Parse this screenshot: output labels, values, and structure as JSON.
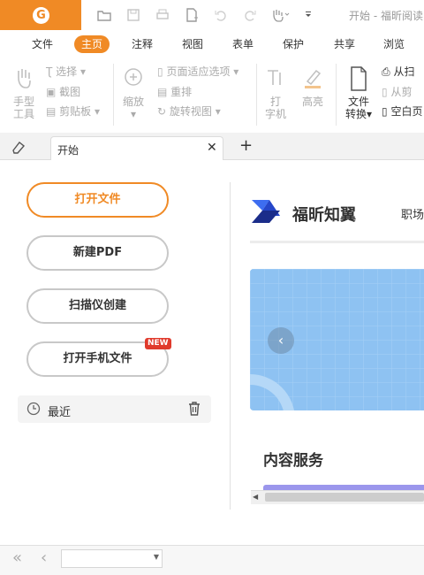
{
  "titlebar": {
    "logo_letter": "G",
    "window_title": "开始 - 福昕阅读",
    "quick_access": [
      "folder-open-icon",
      "save-icon",
      "print-icon",
      "new-doc-icon",
      "undo-icon",
      "redo-icon",
      "hand-tool-icon",
      "customize-icon"
    ]
  },
  "menu": {
    "tabs": [
      "文件",
      "主页",
      "注释",
      "视图",
      "表单",
      "保护",
      "共享",
      "浏览"
    ],
    "active": "主页"
  },
  "ribbon": {
    "hand_tool": "手型\n工具",
    "hand_line1": "手型",
    "hand_line2": "工具",
    "select": "选择",
    "snapshot": "截图",
    "clipboard": "剪贴板",
    "zoom": "缩放",
    "fit_page": "页面适应选项",
    "reflow": "重排",
    "rotate_view": "旋转视图",
    "typewriter_line1": "打",
    "typewriter_line2": "字机",
    "highlight": "高亮",
    "convert_line1": "文件",
    "convert_line2": "转换",
    "from_scanner": "从扫",
    "from_clipboard": "从剪",
    "blank_page": "空白页"
  },
  "doc_tab": {
    "label": "开始",
    "new_tab": "+"
  },
  "start_panel": {
    "open_file": "打开文件",
    "new_pdf": "新建PDF",
    "scanner_create": "扫描仪创建",
    "open_phone_file": "打开手机文件",
    "new_badge": "NEW",
    "recent": "最近"
  },
  "right_panel": {
    "brand": "福昕知翼",
    "nav_item": "职场",
    "section_title": "内容服务"
  },
  "colors": {
    "accent": "#f08a25",
    "brand_blue": "#2f5fe3",
    "badge_red": "#e03a2c",
    "banner": "#8ec2f2"
  }
}
